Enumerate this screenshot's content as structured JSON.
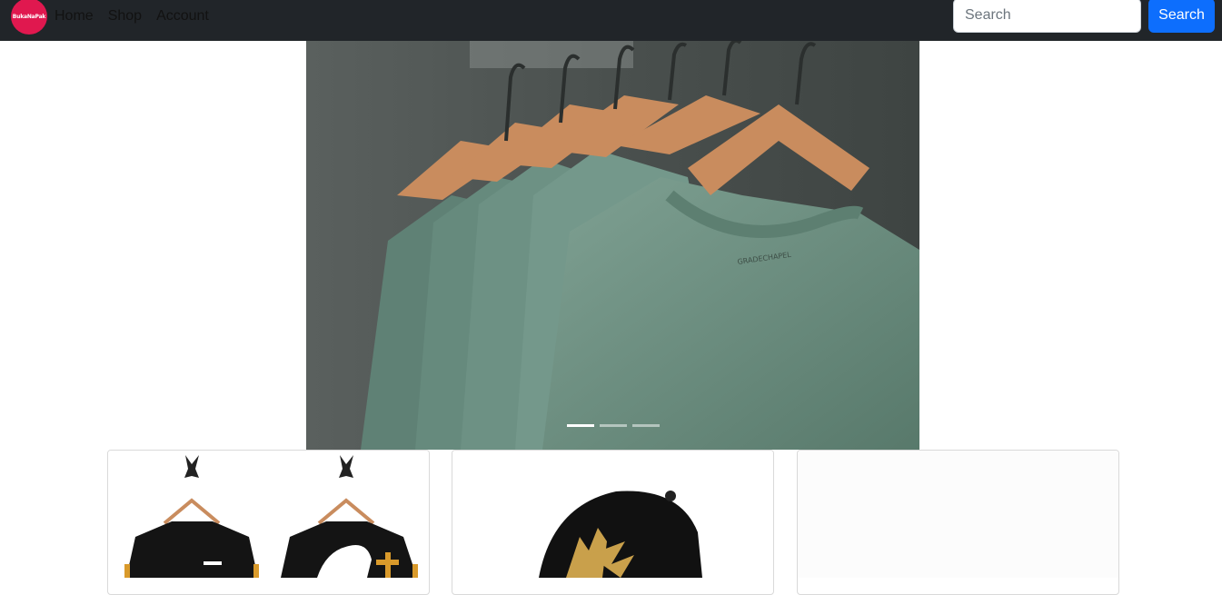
{
  "brand": {
    "logo_text": "BukaNaPak",
    "logo_color": "#e0184f"
  },
  "nav": {
    "links": [
      {
        "label": "Home"
      },
      {
        "label": "Shop"
      },
      {
        "label": "Account"
      }
    ]
  },
  "search": {
    "placeholder": "Search",
    "value": "",
    "button_label": "Search",
    "button_color": "#0d6efd"
  },
  "carousel": {
    "slide_count": 3,
    "active_index": 0,
    "image": "green-tshirts-on-hangers"
  },
  "products": [
    {
      "image": "black-sweatshirts-on-hangers"
    },
    {
      "image": "black-ny-baseball-cap"
    },
    {
      "image": "blank"
    }
  ]
}
